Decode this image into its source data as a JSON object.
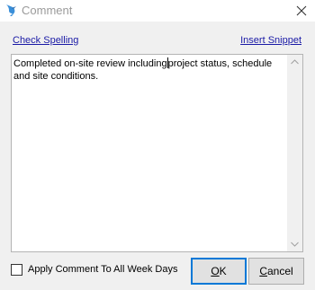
{
  "window": {
    "title": "Comment",
    "app_icon": "bird-icon",
    "close_icon": "close-icon"
  },
  "links": {
    "check_spelling": "Check Spelling",
    "insert_snippet": "Insert Snippet"
  },
  "comment": {
    "text_before_caret": "Completed on-site review including",
    "text_after_caret": "project status, schedule and site conditions."
  },
  "options": {
    "apply_all_week_days_label": "Apply Comment To All Week Days",
    "apply_all_week_days_checked": false
  },
  "buttons": {
    "ok_mnemonic": "O",
    "ok_rest": "K",
    "cancel_mnemonic": "C",
    "cancel_rest": "ancel"
  },
  "colors": {
    "link": "#1a1aa6",
    "default_button_border": "#0078d7",
    "title_text": "#9a9a9a"
  }
}
